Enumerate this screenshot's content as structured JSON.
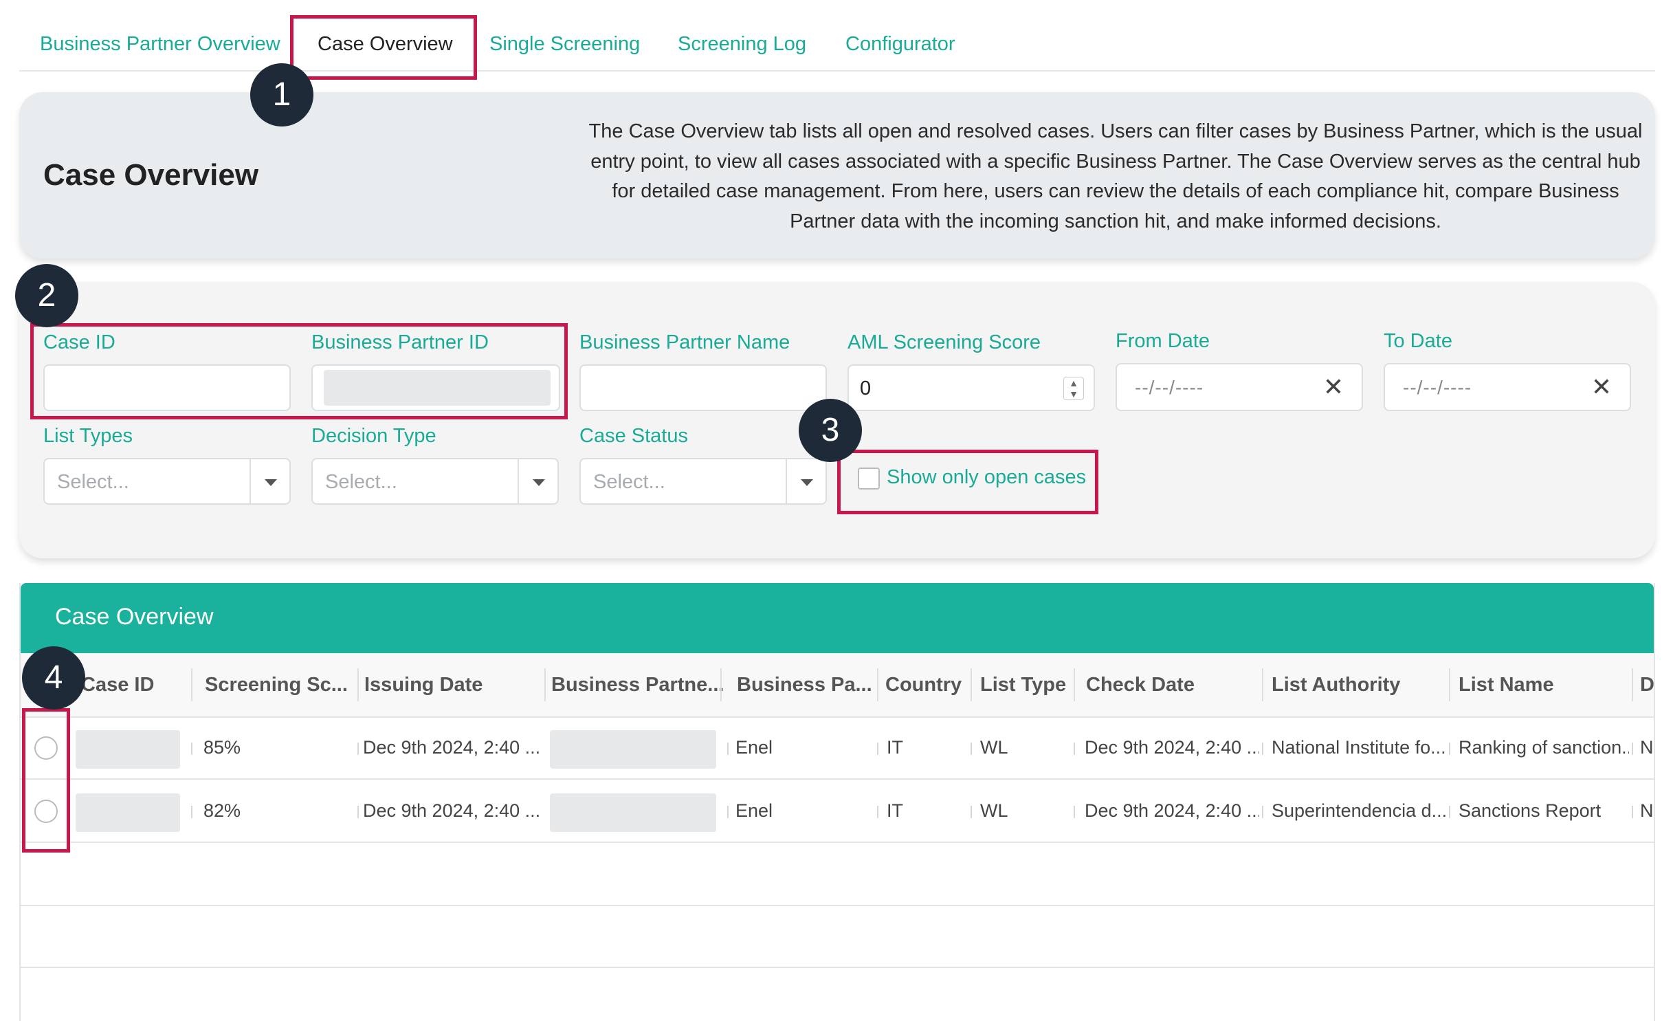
{
  "tabs": [
    {
      "label": "Business Partner Overview"
    },
    {
      "label": "Case Overview"
    },
    {
      "label": "Single Screening"
    },
    {
      "label": "Screening Log"
    },
    {
      "label": "Configurator"
    }
  ],
  "hero": {
    "title": "Case Overview",
    "description": "The Case Overview tab lists all open and resolved cases. Users can filter cases by Business Partner, which is the usual entry point, to view all cases associated with a specific Business Partner. The Case Overview serves as the central hub for detailed case management. From here, users can review the details of each compliance hit, compare Business Partner data with the incoming sanction hit, and make informed decisions."
  },
  "filters": {
    "case_id": {
      "label": "Case ID"
    },
    "bp_id": {
      "label": "Business Partner ID"
    },
    "bp_name": {
      "label": "Business Partner Name"
    },
    "aml_score": {
      "label": "AML Screening Score",
      "value": "0"
    },
    "from_date": {
      "label": "From Date",
      "value": "--/--/----"
    },
    "to_date": {
      "label": "To Date",
      "value": "--/--/----"
    },
    "list_types": {
      "label": "List Types",
      "placeholder": "Select..."
    },
    "decision_type": {
      "label": "Decision Type",
      "placeholder": "Select..."
    },
    "case_status": {
      "label": "Case Status",
      "placeholder": "Select..."
    },
    "open_only": {
      "label": "Show only open cases"
    }
  },
  "table": {
    "title": "Case Overview",
    "columns": [
      "Case ID",
      "Screening Sc...",
      "Issuing Date",
      "Business Partne...",
      "Business Pa...",
      "Country",
      "List Type",
      "Check Date",
      "List Authority",
      "List Name",
      "D"
    ],
    "rows": [
      {
        "score": "85%",
        "issuing_date": "Dec 9th 2024, 2:40 ...",
        "bp_name": "Enel",
        "country": "IT",
        "list_type": "WL",
        "check_date": "Dec 9th 2024, 2:40 ...",
        "authority": "National Institute fo...",
        "list_name": "Ranking of sanction...",
        "d": "N"
      },
      {
        "score": "82%",
        "issuing_date": "Dec 9th 2024, 2:40 ...",
        "bp_name": "Enel",
        "country": "IT",
        "list_type": "WL",
        "check_date": "Dec 9th 2024, 2:40 ...",
        "authority": "Superintendencia d...",
        "list_name": "Sanctions Report",
        "d": "N"
      }
    ]
  },
  "annotations": {
    "callout_1": "1",
    "callout_2": "2",
    "callout_3": "3",
    "callout_4": "4"
  },
  "colors": {
    "accent": "#1aab97",
    "header_bar": "#1ab29c",
    "highlight": "#c8174b",
    "callout": "#1e2a38"
  }
}
